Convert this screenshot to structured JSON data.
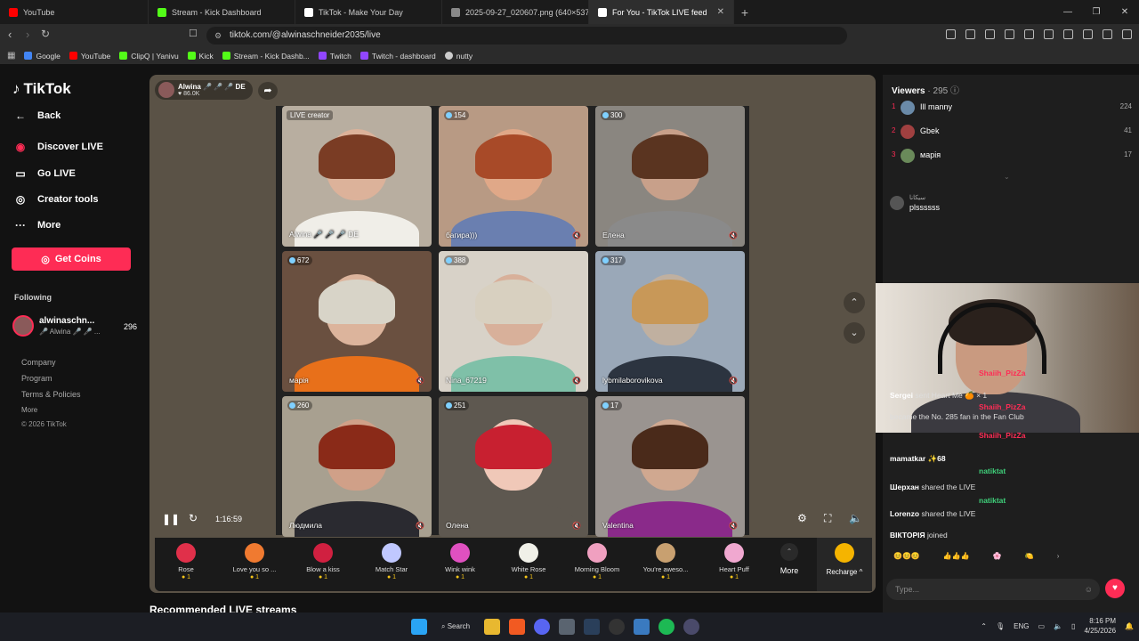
{
  "browser": {
    "tabs": [
      {
        "title": "YouTube",
        "color": "#ff0000"
      },
      {
        "title": "Stream - Kick Dashboard",
        "color": "#53fc18"
      },
      {
        "title": "TikTok - Make Your Day",
        "color": "#ffffff"
      },
      {
        "title": "2025-09-27_020607.png (640×537)",
        "color": "#888888"
      },
      {
        "title": "For You - TikTok LIVE feed",
        "color": "#ffffff"
      }
    ],
    "url": "tiktok.com/@alwinaschneider2035/live",
    "bookmarks": [
      {
        "label": "Google",
        "color": "#4285f4"
      },
      {
        "label": "YouTube",
        "color": "#ff0000"
      },
      {
        "label": "ClipQ | Yanivu",
        "color": "#53fc18"
      },
      {
        "label": "Kick",
        "color": "#53fc18"
      },
      {
        "label": "Stream - Kick Dashb...",
        "color": "#53fc18"
      },
      {
        "label": "Twitch",
        "color": "#9146ff"
      },
      {
        "label": "Twitch - dashboard",
        "color": "#9146ff"
      },
      {
        "label": "nutty",
        "color": "#cccccc"
      }
    ]
  },
  "sidebar": {
    "logo": "TikTok",
    "back": "Back",
    "items": [
      {
        "label": "Discover LIVE",
        "icon": "live-icon"
      },
      {
        "label": "Go LIVE",
        "icon": "camera-icon"
      },
      {
        "label": "Creator tools",
        "icon": "lightbulb-icon"
      },
      {
        "label": "More",
        "icon": "more-icon"
      }
    ],
    "get_coins": "Get Coins",
    "following_title": "Following",
    "following": {
      "name": "alwinaschn...",
      "sub": "🎤 Alwina 🎤 🎤 ...",
      "count": "296"
    },
    "footer": [
      "Company",
      "Program",
      "Terms & Policies"
    ],
    "footer_more": "More",
    "copyright": "© 2026 TikTok"
  },
  "stream": {
    "host_name": "Alwina 🎤 🎤 🎤 DE",
    "host_viewers": "86.0K",
    "time": "1:16:59",
    "cells": [
      {
        "tag": "LIVE creator",
        "name": "Alwina 🎤 🎤 🎤 DE",
        "count": "",
        "hair": "#7a3c24",
        "skin": "#dcb29a",
        "shirt": "#f0eee8"
      },
      {
        "tag": "",
        "name": "багира)))",
        "count": "154",
        "hair": "#a84a28",
        "skin": "#e0a888",
        "shirt": "#6a7fb0"
      },
      {
        "tag": "",
        "name": "Елена",
        "count": "300",
        "hair": "#5a3420",
        "skin": "#c8a08a",
        "shirt": "#8a8a8a"
      },
      {
        "tag": "",
        "name": "марія",
        "count": "672",
        "hair": "#d8d4c8",
        "skin": "#dcb49c",
        "shirt": "#e8701a"
      },
      {
        "tag": "",
        "name": "Nina_67219",
        "count": "388",
        "hair": "#d8d0c0",
        "skin": "#d8b09a",
        "shirt": "#7fc0a8"
      },
      {
        "tag": "",
        "name": "lybmilaborovikova",
        "count": "317",
        "hair": "#c89858",
        "skin": "#c0b0a0",
        "shirt": "#2c3440"
      },
      {
        "tag": "",
        "name": "Людмила",
        "count": "260",
        "hair": "#8a2a18",
        "skin": "#d0a088",
        "shirt": "#2a2a30"
      },
      {
        "tag": "",
        "name": "Олена",
        "count": "251",
        "hair": "#c82030",
        "skin": "#f0c8b8",
        "shirt": "#5e5850"
      },
      {
        "tag": "",
        "name": "Valentina",
        "count": "17",
        "hair": "#4a2a1a",
        "skin": "#d0a890",
        "shirt": "#8a2a8a"
      }
    ]
  },
  "gifts": [
    {
      "name": "Rose",
      "price": "1",
      "color": "#e0304a"
    },
    {
      "name": "Love you so ...",
      "price": "1",
      "color": "#f07a30"
    },
    {
      "name": "Blow a kiss",
      "price": "1",
      "color": "#d02040"
    },
    {
      "name": "Match Star",
      "price": "1",
      "color": "#c0c8ff"
    },
    {
      "name": "Wink wink",
      "price": "1",
      "color": "#e050c0"
    },
    {
      "name": "White Rose",
      "price": "1",
      "color": "#f0f0e8"
    },
    {
      "name": "Morning Bloom",
      "price": "1",
      "color": "#f0a0c0"
    },
    {
      "name": "You're aweso...",
      "price": "1",
      "color": "#c8a070"
    },
    {
      "name": "Heart Puff",
      "price": "1",
      "color": "#f0a8d0"
    }
  ],
  "gifts_more": "More",
  "recharge": "Recharge ^",
  "recommended": "Recommended LIVE streams",
  "chat": {
    "viewers_label": "Viewers",
    "viewers_count": "· 295",
    "viewers": [
      {
        "rank": "1",
        "name": "Ill manny",
        "score": "224"
      },
      {
        "rank": "2",
        "name": "Gbek",
        "score": "41"
      },
      {
        "rank": "3",
        "name": "марія",
        "score": "17"
      }
    ],
    "pinned_user": "سيكانا",
    "pinned_msg": "plssssss",
    "messages": [
      {
        "user": "Shaiih_PizZa",
        "text": "",
        "style": "pink"
      },
      {
        "user": "Sergei",
        "text": "sent Heart Me 🍊 × 1",
        "style": "normal"
      },
      {
        "user": "Shaiih_PizZa",
        "text": "",
        "style": "pink"
      },
      {
        "user": "",
        "text": "became the No. 285 fan in the Fan Club",
        "style": "normal"
      },
      {
        "user": "Shaiih_PizZa",
        "text": "",
        "style": "pink"
      },
      {
        "user": "mamatkar ✨68",
        "text": "",
        "style": "normal"
      },
      {
        "user": "natiktat",
        "text": "",
        "style": "green"
      },
      {
        "user": "Шерхан",
        "text": "shared the LIVE",
        "style": "normal"
      },
      {
        "user": "natiktat",
        "text": "",
        "style": "green"
      },
      {
        "user": "Lorenzo",
        "text": "shared the LIVE",
        "style": "normal"
      },
      {
        "user": "ВІКТОРІЯ",
        "text": "joined",
        "style": "normal"
      }
    ],
    "input_placeholder": "Type..."
  },
  "taskbar": {
    "search": "Search",
    "lang": "ENG",
    "time": "8:16 PM",
    "date": "4/25/2026"
  }
}
